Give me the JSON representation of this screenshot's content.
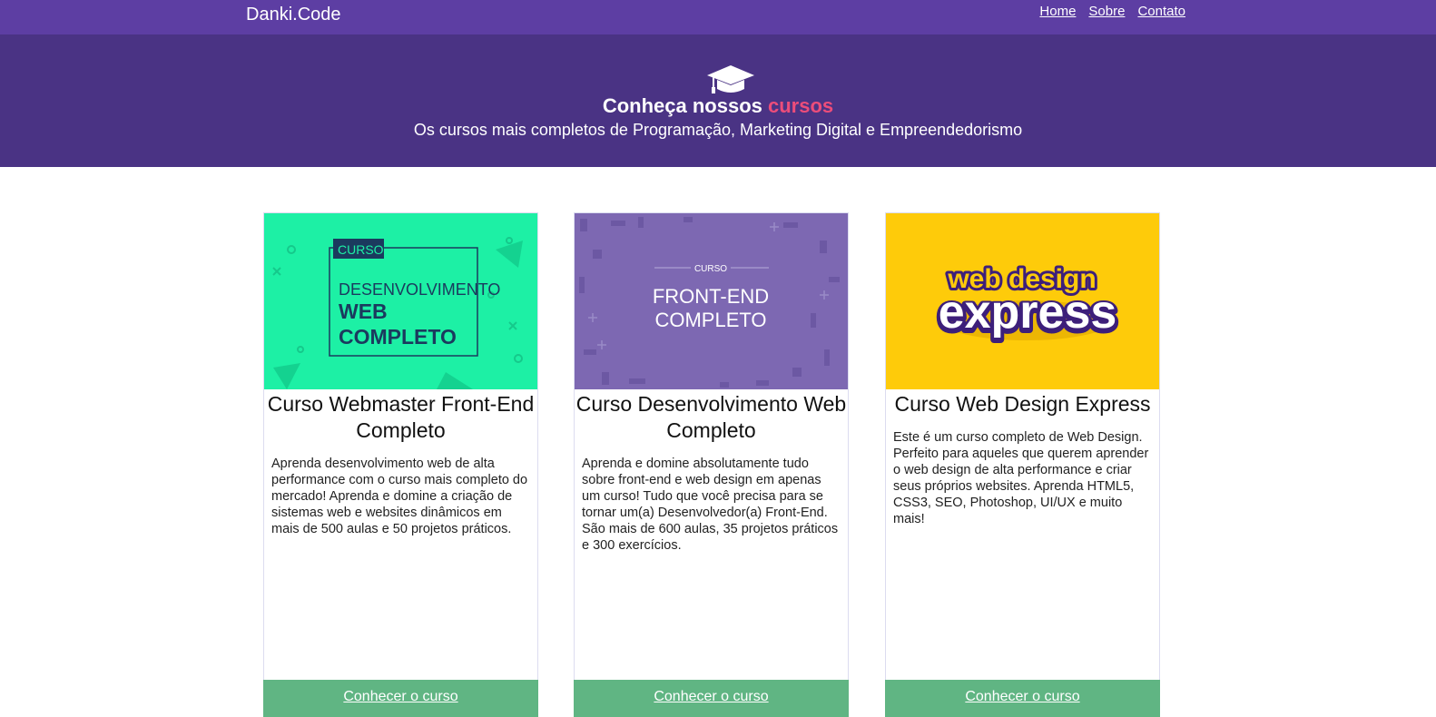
{
  "header": {
    "brand": "Danki.Code",
    "nav": [
      {
        "label": "Home"
      },
      {
        "label": "Sobre"
      },
      {
        "label": "Contato"
      }
    ]
  },
  "hero": {
    "icon": "graduation-cap-icon",
    "title_prefix": "Conheça nossos ",
    "title_highlight": "cursos",
    "subtitle": "Os cursos mais completos de Programação, Marketing Digital e Empreendedorismo"
  },
  "courses": [
    {
      "title": "Curso Webmaster Front-End Completo",
      "description": "Aprenda desenvolvimento web de alta performance com o curso mais completo do mercado! Aprenda e domine a criação de sistemas web e websites dinâmicos em mais de 500 aulas e 50 projetos práticos.",
      "button": "Conhecer o curso",
      "thumb": {
        "tag": "CURSO",
        "line1": "DESENVOLVIMENTO",
        "line2": "WEB",
        "line3": "COMPLETO"
      }
    },
    {
      "title": "Curso Desenvolvimento Web Completo",
      "description": "Aprenda e domine absolutamente tudo sobre front-end e web design em apenas um curso! Tudo que você precisa para se tornar um(a) Desenvolvedor(a) Front-End. São mais de 600 aulas, 35 projetos práticos e 300 exercícios.",
      "button": "Conhecer o curso",
      "thumb": {
        "tag": "CURSO",
        "line1": "FRONT-END",
        "line2": "COMPLETO"
      }
    },
    {
      "title": "Curso Web Design Express",
      "description": "Este é um curso completo de Web Design. Perfeito para aqueles que querem aprender o web design de alta performance e criar seus próprios websites. Aprenda HTML5, CSS3, SEO, Photoshop, UI/UX e muito mais!",
      "button": "Conhecer o curso",
      "thumb": {
        "line1": "web design",
        "line2": "express"
      }
    }
  ],
  "colors": {
    "topbar": "#5d3ea3",
    "hero": "#4a3384",
    "accent": "#ec4d7a",
    "button": "#60b583",
    "thumb1": "#1df0a5",
    "thumb2": "#7d68b2",
    "thumb3": "#fecb0a"
  }
}
